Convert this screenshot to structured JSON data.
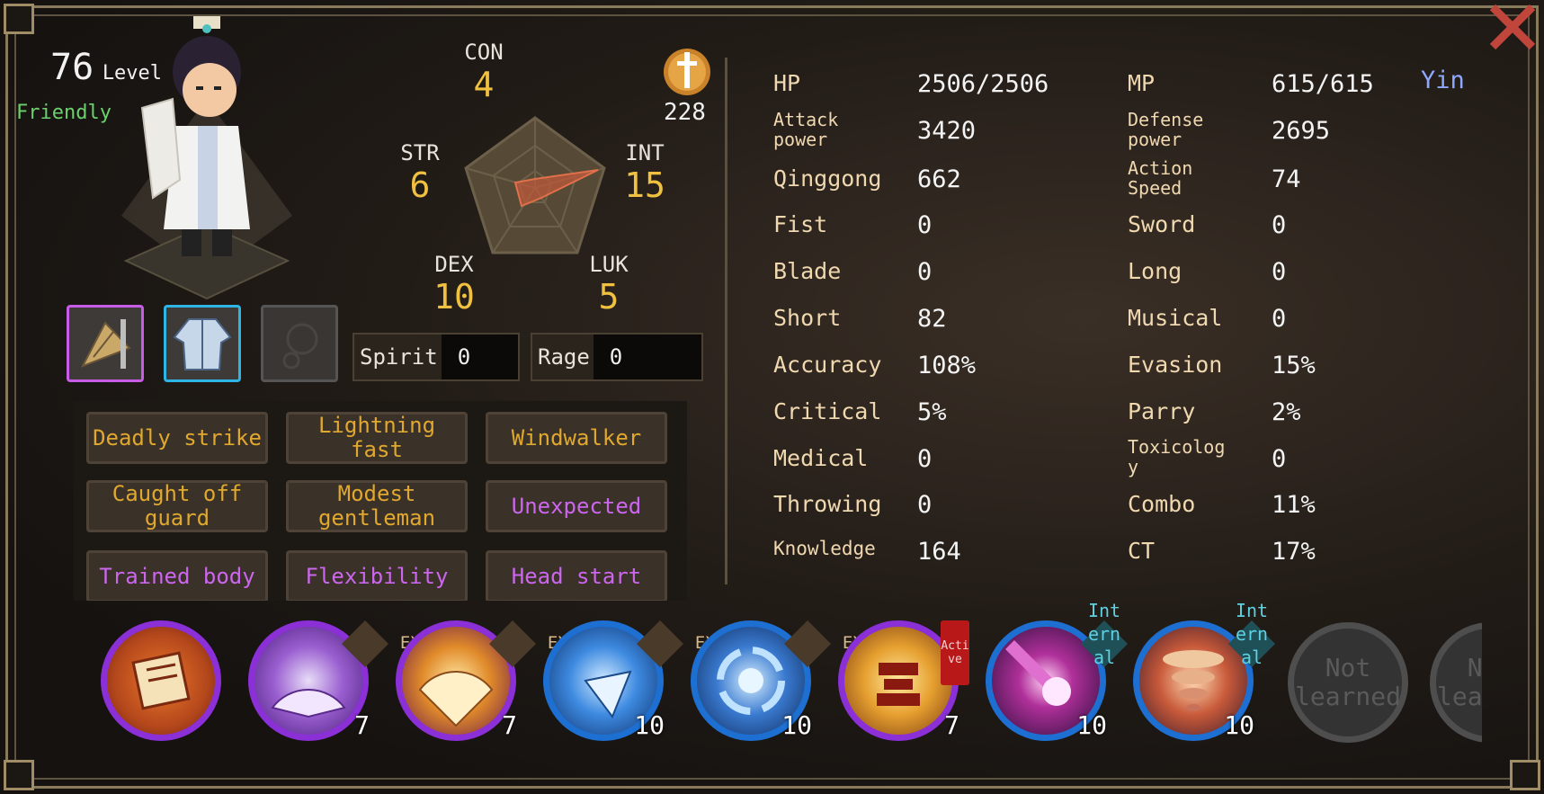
{
  "character": {
    "level": "76",
    "level_label": "Level",
    "attitude": "Friendly"
  },
  "radar": {
    "con": {
      "label": "CON",
      "value": "4"
    },
    "str": {
      "label": "STR",
      "value": "6"
    },
    "int": {
      "label": "INT",
      "value": "15"
    },
    "dex": {
      "label": "DEX",
      "value": "10"
    },
    "luk": {
      "label": "LUK",
      "value": "5"
    }
  },
  "sect": {
    "icon": "sword-emblem-icon",
    "count": "228"
  },
  "equipment": [
    {
      "icon": "fan-weapon-icon",
      "rarity_color": "#c75ce6"
    },
    {
      "icon": "robe-armor-icon",
      "rarity_color": "#2fb4e6"
    },
    {
      "icon": "empty-accessory-icon",
      "rarity_color": "#555555"
    }
  ],
  "resources": {
    "spirit": {
      "label": "Spirit",
      "value": "0"
    },
    "rage": {
      "label": "Rage",
      "value": "0"
    }
  },
  "traits": [
    {
      "text": "Deadly strike",
      "color": "#e0a82e"
    },
    {
      "text": "Lightning fast",
      "color": "#e0a82e"
    },
    {
      "text": "Windwalker",
      "color": "#e0a82e"
    },
    {
      "text": "Caught off guard",
      "color": "#e0a82e"
    },
    {
      "text": "Modest gentleman",
      "color": "#e0a82e"
    },
    {
      "text": "Unexpected",
      "color": "#cc66ee"
    },
    {
      "text": "Trained body",
      "color": "#cc66ee"
    },
    {
      "text": "Flexibility",
      "color": "#cc66ee"
    },
    {
      "text": "Head start",
      "color": "#cc66ee"
    }
  ],
  "stats": {
    "left": [
      {
        "label": "HP",
        "value": "2506/2506"
      },
      {
        "label": "Attack power",
        "value": "3420"
      },
      {
        "label": "Qinggong",
        "value": "662"
      },
      {
        "label": "Fist",
        "value": "0"
      },
      {
        "label": "Blade",
        "value": "0"
      },
      {
        "label": "Short",
        "value": "82"
      },
      {
        "label": "Accuracy",
        "value": "108%"
      },
      {
        "label": "Critical",
        "value": "5%"
      },
      {
        "label": "Medical",
        "value": "0"
      },
      {
        "label": "Throwing",
        "value": "0"
      },
      {
        "label": "Knowledge",
        "value": "164"
      }
    ],
    "right": [
      {
        "label": "MP",
        "value": "615/615"
      },
      {
        "label": "Defense power",
        "value": "2695"
      },
      {
        "label": "Action Speed",
        "value": "74"
      },
      {
        "label": "Sword",
        "value": "0"
      },
      {
        "label": "Long",
        "value": "0"
      },
      {
        "label": "Musical",
        "value": "0"
      },
      {
        "label": "Evasion",
        "value": "15%"
      },
      {
        "label": "Parry",
        "value": "2%"
      },
      {
        "label": "Toxicology",
        "value": "0"
      },
      {
        "label": "Combo",
        "value": "11%"
      },
      {
        "label": "CT",
        "value": "17%"
      }
    ],
    "alignment": "Yin"
  },
  "skills": [
    {
      "icon": "scroll-skill-icon",
      "ring": "#8b2fd6",
      "fill": "#b5481c",
      "tag": "",
      "level": ""
    },
    {
      "icon": "fan-spark-skill-icon",
      "ring": "#8b2fd6",
      "fill": "#7a3aa6",
      "tag": "EXT",
      "level": "7"
    },
    {
      "icon": "fan-flame-skill-icon",
      "ring": "#8b2fd6",
      "fill": "#c46a20",
      "tag": "EXT",
      "level": "7"
    },
    {
      "icon": "fan-wave-skill-icon",
      "ring": "#1d6fd1",
      "fill": "#1f5fb8",
      "tag": "EXT",
      "level": "10"
    },
    {
      "icon": "vortex-skill-icon",
      "ring": "#1d6fd1",
      "fill": "#1b4e9a",
      "tag": "EXT",
      "level": "10"
    },
    {
      "icon": "pagoda-skill-icon",
      "ring": "#8b2fd6",
      "fill": "#d28a1e",
      "tag": "Active",
      "level": "7"
    },
    {
      "icon": "comet-skill-icon",
      "ring": "#1d6fd1",
      "fill": "#5a2470",
      "tag": "Internal",
      "level": "10"
    },
    {
      "icon": "tornado-skill-icon",
      "ring": "#1d6fd1",
      "fill": "#8a3a2a",
      "tag": "Internal",
      "level": "10"
    },
    {
      "icon": "not-learned-slot-icon",
      "ring": "#555555",
      "fill": "#3a3a3a",
      "tag": "",
      "level": "",
      "text": "Not learned"
    },
    {
      "icon": "not-learned-slot-icon",
      "ring": "#555555",
      "fill": "#3a3a3a",
      "tag": "",
      "level": "",
      "text": "Not learned"
    }
  ]
}
